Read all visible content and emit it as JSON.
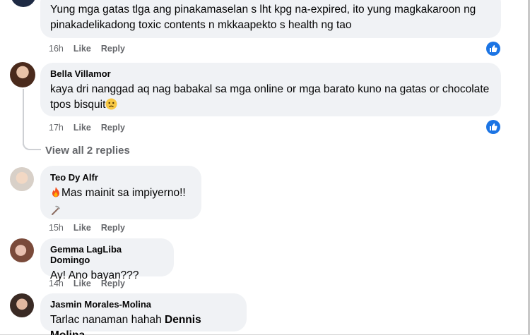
{
  "comments": [
    {
      "author": "",
      "text": "Yung mga gatas tlga ang pinakamaselan s lht kpg na-expired, ito yung magkakaroon ng pinakadelikadong toxic contents n mkkaapekto s health ng tao",
      "time": "16h",
      "like_label": "Like",
      "reply_label": "Reply",
      "has_reaction": true
    },
    {
      "author": "Bella Villamor",
      "text": "kaya dri nanggad aq nag babakal sa mga online or mga barato kuno na gatas or chocolate tpos bisquit",
      "time": "17h",
      "like_label": "Like",
      "reply_label": "Reply",
      "has_reaction": true
    },
    {
      "author": "Teo Dy Alfr",
      "text": "Mas mainit sa impiyerno!!",
      "time": "15h",
      "like_label": "Like",
      "reply_label": "Reply",
      "has_reaction": false
    },
    {
      "author": "Gemma LagLiba Domingo",
      "text": "Ay! Ano bayan???",
      "time": "14h",
      "like_label": "Like",
      "reply_label": "Reply",
      "has_reaction": false
    },
    {
      "author": "Jasmin Morales-Molina",
      "text": "Tarlac nanaman hahah",
      "mention": "Dennis Molina",
      "has_reaction": false
    }
  ],
  "view_replies_label": "View all 2 replies",
  "icons": {
    "reaction": "like-thumb-icon",
    "emoji_bella": "worried-face-emoji",
    "emoji_teo_fire": "fire-emoji",
    "emoji_teo_pick": "pick-emoji"
  },
  "colors": {
    "bubble": "#f0f2f5",
    "meta": "#65676b",
    "like_blue": "#1b74e4"
  }
}
